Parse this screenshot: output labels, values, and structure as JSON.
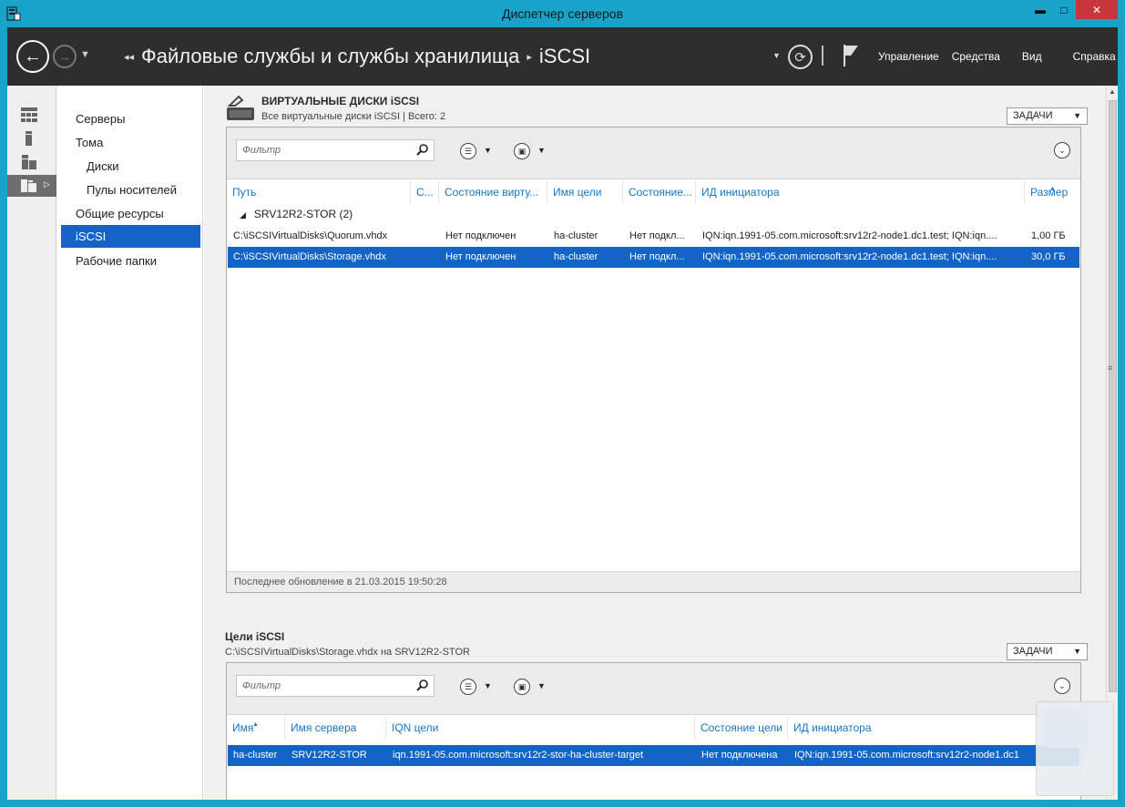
{
  "window": {
    "title": "Диспетчер серверов",
    "buttons": {
      "minimize": "▬",
      "maximize": "□",
      "close": "✕"
    }
  },
  "header": {
    "breadcrumb": [
      "Файловые службы и службы хранилища",
      "iSCSI"
    ],
    "menu": [
      "Управление",
      "Средства",
      "Вид",
      "Справка"
    ],
    "icons": [
      "back-icon",
      "forward-icon",
      "refresh-icon",
      "notifications-flag-icon"
    ]
  },
  "sidebar": {
    "icons": [
      "dashboard-icon",
      "local-server-icon",
      "all-servers-icon",
      "file-storage-services-icon"
    ],
    "items": [
      {
        "label": "Серверы",
        "sub": false,
        "selected": false
      },
      {
        "label": "Тома",
        "sub": false,
        "selected": false
      },
      {
        "label": "Диски",
        "sub": true,
        "selected": false
      },
      {
        "label": "Пулы носителей",
        "sub": true,
        "selected": false
      },
      {
        "label": "Общие ресурсы",
        "sub": false,
        "selected": false
      },
      {
        "label": "iSCSI",
        "sub": false,
        "selected": true
      },
      {
        "label": "Рабочие папки",
        "sub": false,
        "selected": false
      }
    ]
  },
  "virtual_disks": {
    "title": "ВИРТУАЛЬНЫЕ ДИСКИ iSCSI",
    "subtitle": "Все виртуальные диски iSCSI | Всего: 2",
    "tasks_label": "ЗАДАЧИ",
    "filter_placeholder": "Фильтр",
    "columns": [
      "Путь",
      "С...",
      "Состояние вирту...",
      "Имя цели",
      "Состояние...",
      "ИД инициатора",
      "Размер"
    ],
    "group_label": "SRV12R2-STOR (2)",
    "rows": [
      [
        "C:\\iSCSIVirtualDisks\\Quorum.vhdx",
        "",
        "Нет подключен",
        "ha-cluster",
        "Нет подкл...",
        "IQN:iqn.1991-05.com.microsoft:srv12r2-node1.dc1.test; IQN:iqn....",
        "1,00 ГБ"
      ],
      [
        "C:\\iSCSIVirtualDisks\\Storage.vhdx",
        "",
        "Нет подключен",
        "ha-cluster",
        "Нет подкл...",
        "IQN:iqn.1991-05.com.microsoft:srv12r2-node1.dc1.test; IQN:iqn....",
        "30,0 ГБ"
      ]
    ],
    "selected_row": 1,
    "status": "Последнее обновление в 21.03.2015 19:50:28"
  },
  "targets": {
    "title": "Цели iSCSI",
    "subtitle": "C:\\iSCSIVirtualDisks\\Storage.vhdx на SRV12R2-STOR",
    "tasks_label": "ЗАДАЧИ",
    "filter_placeholder": "Фильтр",
    "columns": [
      "Имя",
      "Имя сервера",
      "IQN цели",
      "Состояние цели",
      "ИД инициатора"
    ],
    "rows": [
      [
        "ha-cluster",
        "SRV12R2-STOR",
        "iqn.1991-05.com.microsoft:srv12r2-stor-ha-cluster-target",
        "Нет подключена",
        "IQN:iqn.1991-05.com.microsoft:srv12r2-node1.dc1"
      ]
    ]
  },
  "colors": {
    "accent": "#1464c8",
    "chrome": "#19a3c8",
    "header": "#2e2e2e",
    "link": "#1677c4"
  }
}
